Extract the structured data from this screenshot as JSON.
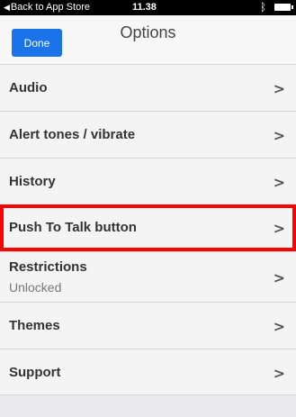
{
  "status_bar": {
    "back_label": "Back to App Store",
    "time": "11.38"
  },
  "nav": {
    "done_label": "Done",
    "title": "Options"
  },
  "items": [
    {
      "label": "Audio",
      "sub": ""
    },
    {
      "label": "Alert tones / vibrate",
      "sub": ""
    },
    {
      "label": "History",
      "sub": ""
    },
    {
      "label": "Push To Talk button",
      "sub": ""
    },
    {
      "label": "Restrictions",
      "sub": "Unlocked"
    },
    {
      "label": "Themes",
      "sub": ""
    },
    {
      "label": "Support",
      "sub": ""
    }
  ],
  "colors": {
    "accent": "#1a73e8",
    "highlight": "#ff0000"
  },
  "icons": {
    "chevron": "chevron-right-icon",
    "bluetooth": "bluetooth-icon",
    "battery": "battery-icon"
  }
}
